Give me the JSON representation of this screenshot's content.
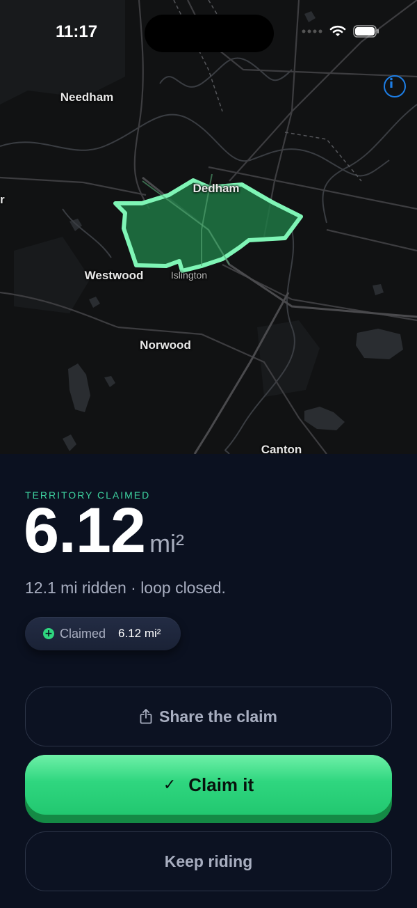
{
  "status_bar": {
    "time": "11:17"
  },
  "map": {
    "labels": {
      "needham": "Needham",
      "dedham": "Dedham",
      "westwood": "Westwood",
      "islington": "Islington",
      "norwood": "Norwood",
      "canton": "Canton",
      "edge_left": "r"
    },
    "territory_color": "#3ddc91"
  },
  "sheet": {
    "eyebrow": "TERRITORY CLAIMED",
    "area_value": "6.12",
    "area_unit": "mi²",
    "subtitle": "12.1 mi ridden · loop closed.",
    "chip": {
      "icon": "plus-circle-icon",
      "label": "Claimed",
      "value": "6.12 mi²"
    },
    "buttons": {
      "share": {
        "label": "Share the claim",
        "icon": "share-icon"
      },
      "claim": {
        "label": "Claim it",
        "icon": "check-icon"
      },
      "keep": {
        "label": "Keep riding"
      }
    }
  },
  "colors": {
    "accent": "#2fd67f",
    "eyebrow": "#3ed3a0",
    "background": "#0b1120",
    "info": "#1d7ee6"
  }
}
